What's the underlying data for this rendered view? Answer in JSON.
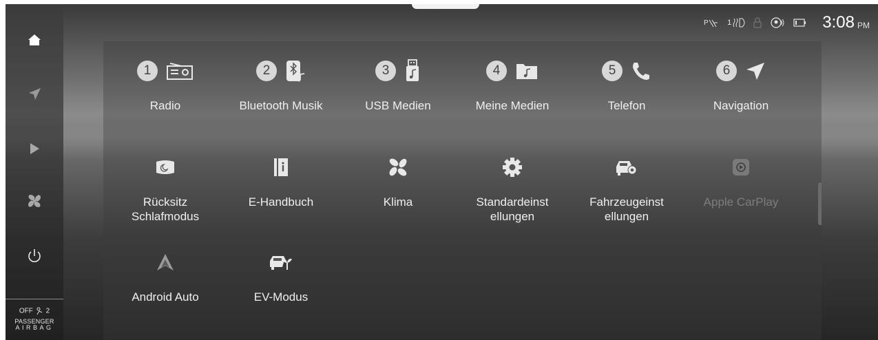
{
  "status": {
    "time": "3:08",
    "ampm": "PM",
    "icons": [
      "parking-sensor-off-icon",
      "seat-heat-icon",
      "lock-icon",
      "driver-profile-icon",
      "battery-icon"
    ],
    "seat_level": "1"
  },
  "side_nav": [
    "home-icon",
    "navigation-icon",
    "play-icon",
    "fan-icon",
    "power-icon"
  ],
  "airbag": {
    "off": "OFF",
    "indicator": "2",
    "line1": "PASSENGER",
    "line2": "AIRBAG"
  },
  "apps": [
    {
      "num": "1",
      "label": "Radio",
      "icon": "radio-icon"
    },
    {
      "num": "2",
      "label": "Bluetooth Musik",
      "icon": "bluetooth-music-icon"
    },
    {
      "num": "3",
      "label": "USB Medien",
      "icon": "usb-media-icon"
    },
    {
      "num": "4",
      "label": "Meine Medien",
      "icon": "my-media-folder-icon"
    },
    {
      "num": "5",
      "label": "Telefon",
      "icon": "phone-icon"
    },
    {
      "num": "6",
      "label": "Navigation",
      "icon": "navigation-arrow-icon"
    },
    {
      "label": "Rücksitz Schlafmodus",
      "icon": "rear-seat-sleep-icon"
    },
    {
      "label": "E-Handbuch",
      "icon": "e-manual-icon"
    },
    {
      "label": "Klima",
      "icon": "climate-fan-icon"
    },
    {
      "label": "Standardeinst ellungen",
      "icon": "settings-gear-icon"
    },
    {
      "label": "Fahrzeugeinst ellungen",
      "icon": "vehicle-settings-icon"
    },
    {
      "label": "Apple CarPlay",
      "icon": "carplay-icon",
      "disabled": true
    },
    {
      "label": "Android Auto",
      "icon": "android-auto-icon"
    },
    {
      "label": "EV-Modus",
      "icon": "ev-mode-icon"
    }
  ]
}
